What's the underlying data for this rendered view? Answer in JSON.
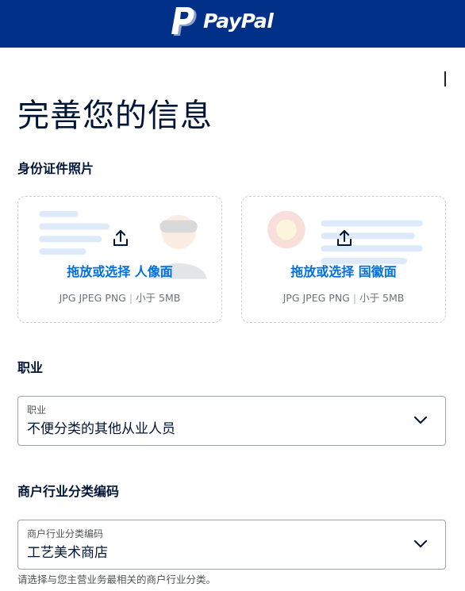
{
  "header": {
    "brand": "PayPal",
    "logo_icon": "paypal-p-logo",
    "bg_color": "#003087"
  },
  "page": {
    "title": "完善您的信息"
  },
  "id_photo": {
    "section_title": "身份证件照片",
    "front": {
      "action_label": "拖放或选择 人像面",
      "formats": "JPG JPEG PNG",
      "size_limit": "小于 5MB",
      "icon": "upload-icon"
    },
    "back": {
      "action_label": "拖放或选择 国徽面",
      "formats": "JPG JPEG PNG",
      "size_limit": "小于 5MB",
      "icon": "upload-icon"
    }
  },
  "occupation": {
    "section_title": "职业",
    "field_label": "职业",
    "value": "不便分类的其他从业人员"
  },
  "merchant_category": {
    "section_title": "商户行业分类编码",
    "field_label": "商户行业分类编码",
    "value": "工艺美术商店",
    "helper": "请选择与您主营业务最相关的商户行业分类。"
  },
  "colors": {
    "link": "#0070e0",
    "text": "#001435"
  }
}
